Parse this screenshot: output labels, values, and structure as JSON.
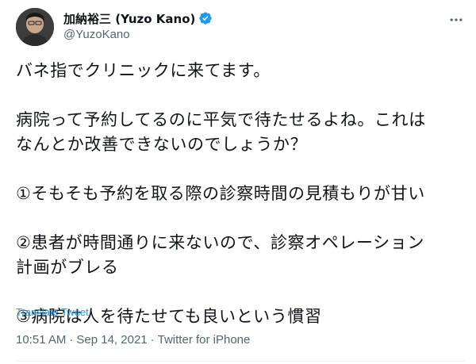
{
  "author": {
    "display_name": "加納裕三 (Yuzo Kano)",
    "handle": "@YuzoKano",
    "verified": true
  },
  "tweet": {
    "paragraphs": [
      [
        "バネ指でクリニックに来てます。"
      ],
      [
        "病院って予約してるのに平気で待たせるよね。これは",
        "なんとか改善できないのでしょうか？"
      ],
      [
        "①そもそも予約を取る際の診察時間の見積もりが甘い"
      ],
      [
        "②患者が時間通りに来ないので、診察オペレーション",
        "計画がブレる"
      ],
      [
        "③病院は人を待たせても良いという慣習"
      ]
    ],
    "translate_label": "Translate Tweet",
    "time": "10:51 AM",
    "date": "Sep 14, 2021",
    "separator": "·",
    "source": "Twitter for iPhone"
  },
  "icons": {
    "verified": "verified-badge-icon",
    "more": "more-horizontal-icon"
  },
  "colors": {
    "text": "#0f1419",
    "secondary": "#536471",
    "accent": "#1d9bf0"
  }
}
